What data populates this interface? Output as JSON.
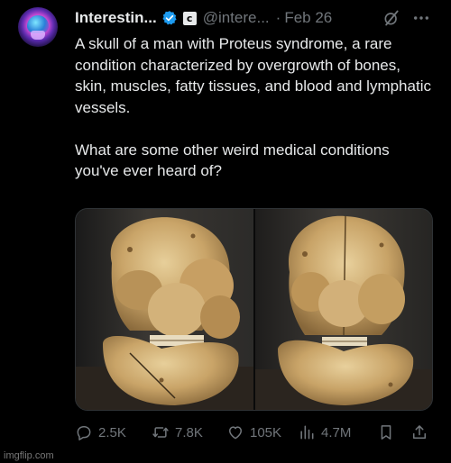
{
  "post": {
    "author_name": "Interestin...",
    "handle": "@intere...",
    "separator": "·",
    "date": "Feb 26",
    "badge_letter": "c",
    "paragraphs": [
      "A skull of a man with Proteus syndrome, a rare condition characterized by overgrowth of bones, skin, muscles, fatty tissues, and blood and lymphatic vessels.",
      "What are some other weird medical conditions you've ever heard of?"
    ],
    "media": {
      "images": [
        "skull-front-view",
        "skull-front-view-2"
      ]
    }
  },
  "actions": {
    "replies": "2.5K",
    "reposts": "7.8K",
    "likes": "105K",
    "views": "4.7M"
  },
  "colors": {
    "background": "#000000",
    "text": "#e7e9ea",
    "secondary": "#71767b",
    "verified": "#1d9bf0"
  },
  "icons": [
    "verified-icon",
    "grok-slash-icon",
    "more-icon",
    "reply-icon",
    "repost-icon",
    "like-icon",
    "views-icon",
    "bookmark-icon",
    "share-icon"
  ],
  "watermark": "imgflip.com"
}
